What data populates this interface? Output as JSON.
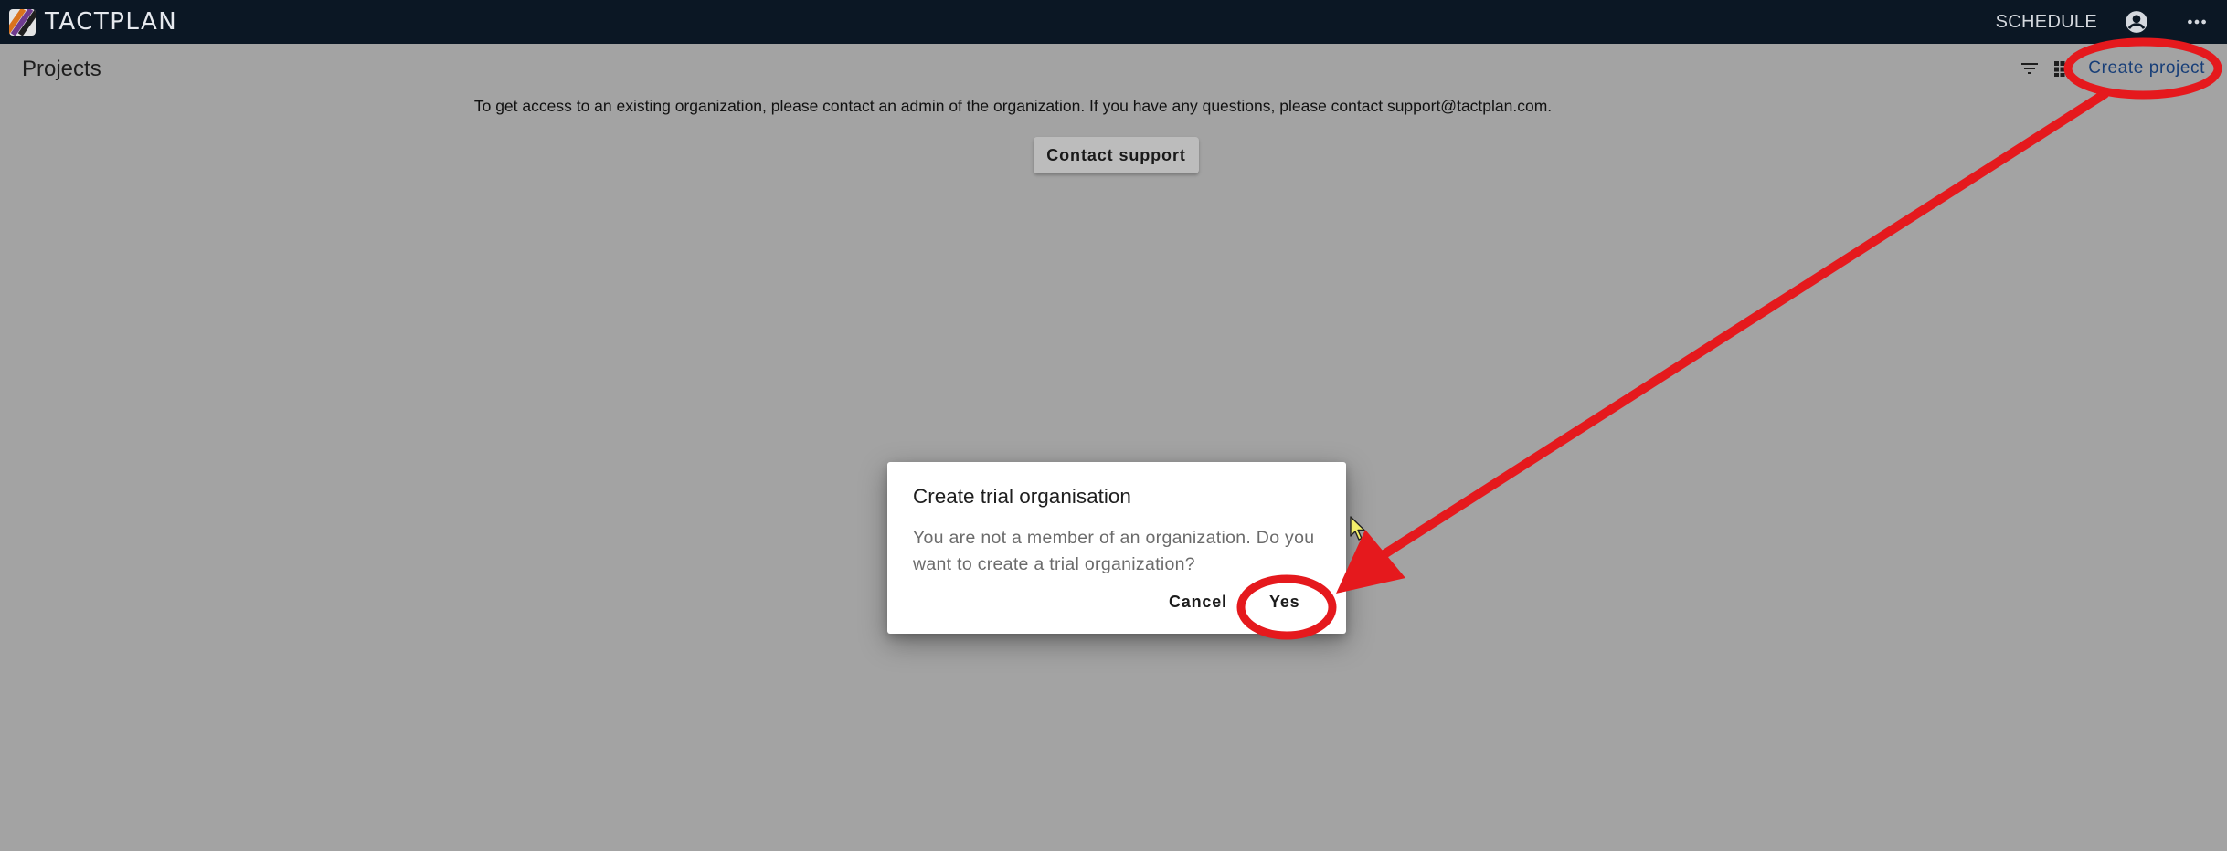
{
  "app": {
    "name": "TACTPLAN",
    "colors": {
      "topbar": "#0b1724",
      "overlay": "#a3a3a3",
      "link": "#173e78",
      "annotation": "#e5191d",
      "logo_stripes": [
        "#d9731d",
        "#6f3b8f",
        "#1f1f1f"
      ]
    }
  },
  "topbar": {
    "logo_icon": "tactplan-logo-icon",
    "schedule_label": "SCHEDULE",
    "account_icon": "account-circle-icon",
    "more_icon": "more-horizontal-icon"
  },
  "page": {
    "title": "Projects",
    "filter_icon": "filter-icon",
    "view_icon": "grid-view-icon",
    "create_project_label": "Create project",
    "info_text": "To get access to an existing organization, please contact an admin of the organization. If you have any questions, please contact support@tactplan.com.",
    "contact_support_label": "Contact support"
  },
  "dialog": {
    "title": "Create trial organisation",
    "body": "You are not a member of an organization. Do you want to create a trial organization?",
    "cancel_label": "Cancel",
    "yes_label": "Yes"
  },
  "annotations": {
    "circles": [
      "create-project-circle",
      "yes-button-circle"
    ],
    "arrow": "arrow-from-create-project-to-yes"
  }
}
